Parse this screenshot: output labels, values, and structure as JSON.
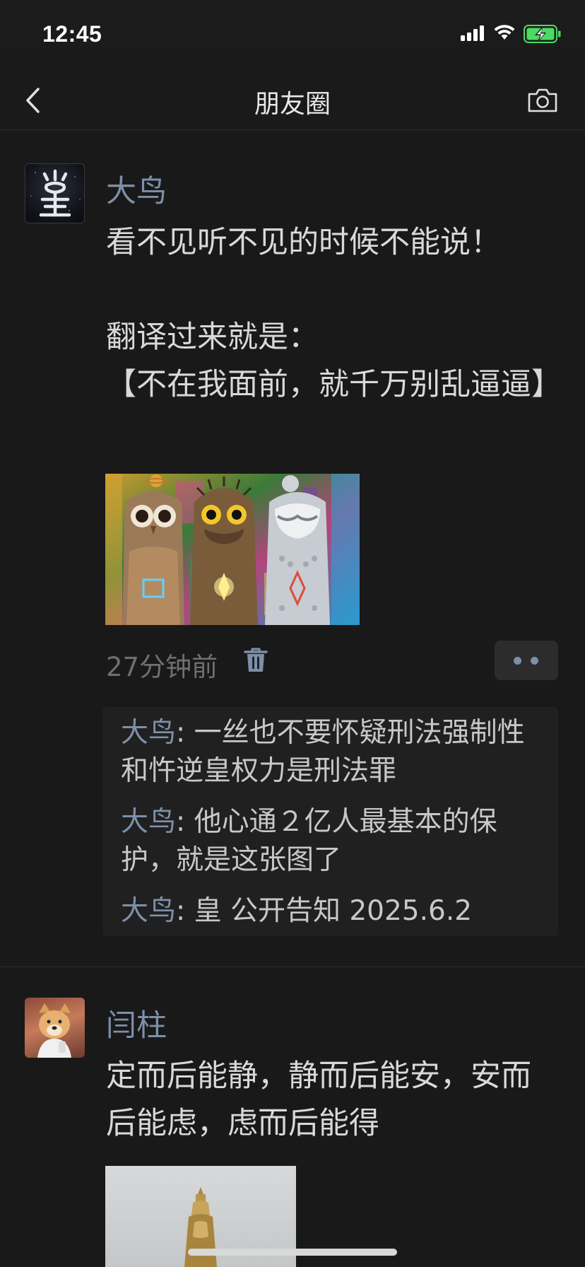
{
  "status_bar": {
    "time": "12:45"
  },
  "nav": {
    "title": "朋友圈"
  },
  "posts": [
    {
      "author": "大鸟",
      "text": "看不见听不见的时候不能说！\n\n翻译过来就是：\n【不在我面前，就千万别乱逼逼】",
      "time": "27分钟前",
      "comments": [
        {
          "name": "大鸟",
          "sep": ": ",
          "text": "一丝也不要怀疑刑法强制性和忤逆皇权力是刑法罪"
        },
        {
          "name": "大鸟",
          "sep": ": ",
          "text": "他心通２亿人最基本的保护，就是这张图了"
        },
        {
          "name": "大鸟",
          "sep": ": ",
          "text": "皇 公开告知 2025.6.2"
        }
      ]
    },
    {
      "author": "闫柱",
      "text": "定而后能静，静而后能安，安而后能虑，虑而后能得"
    }
  ],
  "icons": {
    "back": "chevron-left-icon",
    "camera": "camera-icon",
    "trash": "trash-icon",
    "more": "more-dots-icon"
  },
  "colors": {
    "background": "#191919",
    "name_link": "#7d90a9",
    "battery": "#4cd964"
  }
}
